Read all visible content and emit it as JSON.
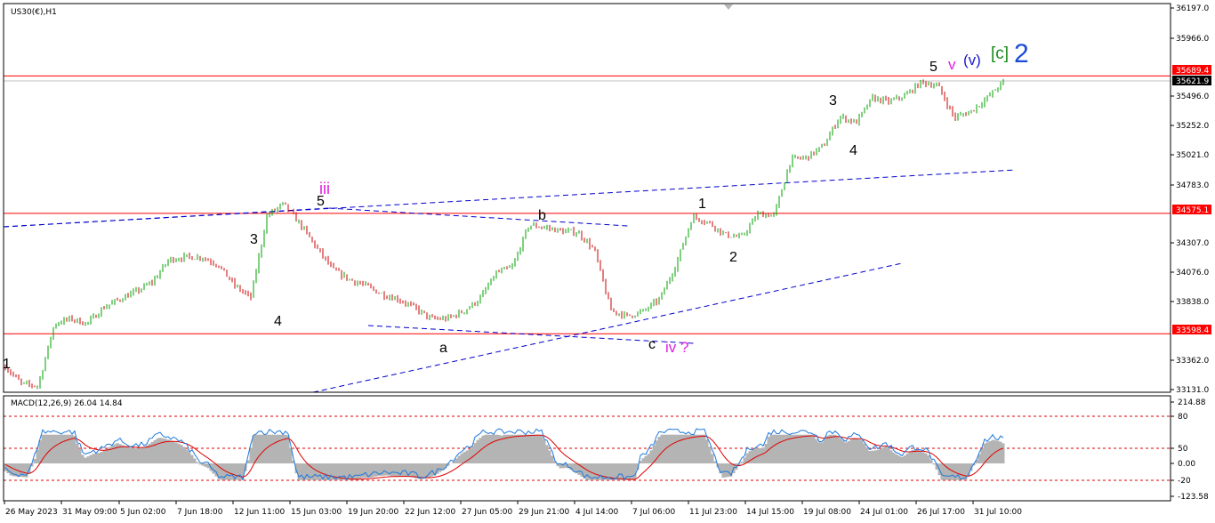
{
  "symbol_label": "US30(€),H1",
  "macd_label": "MACD(12,26,9) 26.04 14.84",
  "colors": {
    "background": "#ffffff",
    "grid_frame": "#000000",
    "bull_candle": "#00a000",
    "bear_candle": "#c80000",
    "level_line": "#ff0000",
    "trend_line": "#0000cc",
    "macd_hist": "#b4b4b4",
    "macd_main": "#1e78dc",
    "macd_signal": "#e00000",
    "magenta": "#e11fe1",
    "navy": "#1a1ad0",
    "green": "#1a8a1a",
    "blue": "#1a4ad8"
  },
  "price_axis": {
    "ticks": [
      "36197.0",
      "35966.0",
      "35689.4",
      "35621.9",
      "35496.0",
      "35252.0",
      "35021.0",
      "34783.0",
      "34575.1",
      "34307.0",
      "34076.0",
      "33838.0",
      "33598.4",
      "33362.0",
      "33131.0"
    ],
    "highlight": [
      {
        "value": "35689.4",
        "color": "#ff0000"
      },
      {
        "value": "35621.9",
        "color": "#000000"
      },
      {
        "value": "34575.1",
        "color": "#ff0000"
      },
      {
        "value": "33598.4",
        "color": "#ff0000"
      }
    ]
  },
  "macd_axis": {
    "ticks": [
      "214.88",
      "80",
      "50",
      "0.00",
      "-20",
      "-123.58"
    ]
  },
  "time_axis": {
    "labels": [
      "26 May 2023",
      "31 May 09:00",
      "5 Jun 02:00",
      "7 Jun 18:00",
      "12 Jun 11:00",
      "15 Jun 03:00",
      "19 Jun 20:00",
      "22 Jun 12:00",
      "27 Jun 05:00",
      "29 Jun 21:00",
      "4 Jul 14:00",
      "7 Jul 06:00",
      "11 Jul 23:00",
      "14 Jul 15:00",
      "19 Jul 08:00",
      "24 Jul 01:00",
      "26 Jul 17:00",
      "31 Jul 10:00"
    ]
  },
  "wave_labels": [
    {
      "text": "1",
      "color": "#000000"
    },
    {
      "text": "3",
      "color": "#000000"
    },
    {
      "text": "4",
      "color": "#000000"
    },
    {
      "text": "5",
      "color": "#000000"
    },
    {
      "text": "iii",
      "color": "#e11fe1"
    },
    {
      "text": "a",
      "color": "#000000"
    },
    {
      "text": "b",
      "color": "#000000"
    },
    {
      "text": "c",
      "color": "#000000"
    },
    {
      "text": "iv ?",
      "color": "#e11fe1"
    },
    {
      "text": "1",
      "color": "#000000"
    },
    {
      "text": "2",
      "color": "#000000"
    },
    {
      "text": "3",
      "color": "#000000"
    },
    {
      "text": "4",
      "color": "#000000"
    },
    {
      "text": "5",
      "color": "#000000"
    },
    {
      "text": "v",
      "color": "#e11fe1"
    },
    {
      "text": "(v)",
      "color": "#1a1ad0"
    },
    {
      "text": "[c]",
      "color": "#1a8a1a"
    },
    {
      "text": "2",
      "color": "#1a4ad8"
    }
  ],
  "chart_data": {
    "type": "candlestick",
    "timeframe": "H1",
    "x_labels": [
      "26 May 2023",
      "31 May 09:00",
      "5 Jun 02:00",
      "7 Jun 18:00",
      "12 Jun 11:00",
      "15 Jun 03:00",
      "19 Jun 20:00",
      "22 Jun 12:00",
      "27 Jun 05:00",
      "29 Jun 21:00",
      "4 Jul 14:00",
      "7 Jul 06:00",
      "11 Jul 23:00",
      "14 Jul 15:00",
      "19 Jul 08:00",
      "24 Jul 01:00",
      "26 Jul 17:00",
      "31 Jul 10:00"
    ],
    "ylim": [
      33131,
      36197
    ],
    "price_path": [
      [
        0,
        33330
      ],
      [
        1,
        33190
      ],
      [
        2,
        33175
      ],
      [
        3,
        33680
      ],
      [
        4,
        33720
      ],
      [
        5,
        33680
      ],
      [
        6,
        33810
      ],
      [
        7,
        33880
      ],
      [
        8,
        33940
      ],
      [
        9,
        34020
      ],
      [
        10,
        34200
      ],
      [
        11,
        34220
      ],
      [
        12,
        34220
      ],
      [
        13,
        34160
      ],
      [
        14,
        33990
      ],
      [
        15,
        33890
      ],
      [
        16,
        34560
      ],
      [
        17,
        34650
      ],
      [
        18,
        34490
      ],
      [
        19,
        34300
      ],
      [
        20,
        34120
      ],
      [
        21,
        34040
      ],
      [
        22,
        33990
      ],
      [
        23,
        33920
      ],
      [
        24,
        33880
      ],
      [
        25,
        33810
      ],
      [
        26,
        33720
      ],
      [
        27,
        33720
      ],
      [
        28,
        33780
      ],
      [
        29,
        33880
      ],
      [
        30,
        34090
      ],
      [
        31,
        34140
      ],
      [
        32,
        34480
      ],
      [
        33,
        34460
      ],
      [
        34,
        34430
      ],
      [
        35,
        34420
      ],
      [
        36,
        34280
      ],
      [
        37,
        33790
      ],
      [
        38,
        33740
      ],
      [
        39,
        33780
      ],
      [
        40,
        33880
      ],
      [
        41,
        34160
      ],
      [
        42,
        34550
      ],
      [
        43,
        34500
      ],
      [
        44,
        34400
      ],
      [
        45,
        34380
      ],
      [
        46,
        34570
      ],
      [
        47,
        34560
      ],
      [
        48,
        35010
      ],
      [
        49,
        35030
      ],
      [
        50,
        35120
      ],
      [
        51,
        35360
      ],
      [
        52,
        35310
      ],
      [
        53,
        35510
      ],
      [
        54,
        35480
      ],
      [
        55,
        35530
      ],
      [
        56,
        35640
      ],
      [
        57,
        35610
      ],
      [
        58,
        35350
      ],
      [
        59,
        35400
      ],
      [
        60,
        35510
      ],
      [
        61,
        35640
      ]
    ],
    "levels": [
      35689.4,
      34575.1,
      33598.4
    ],
    "macd": {
      "params": "12,26,9",
      "main": 26.04,
      "signal": 14.84,
      "levels": [
        80,
        50,
        0,
        -20
      ],
      "ylim": [
        -123.58,
        214.88
      ]
    }
  }
}
